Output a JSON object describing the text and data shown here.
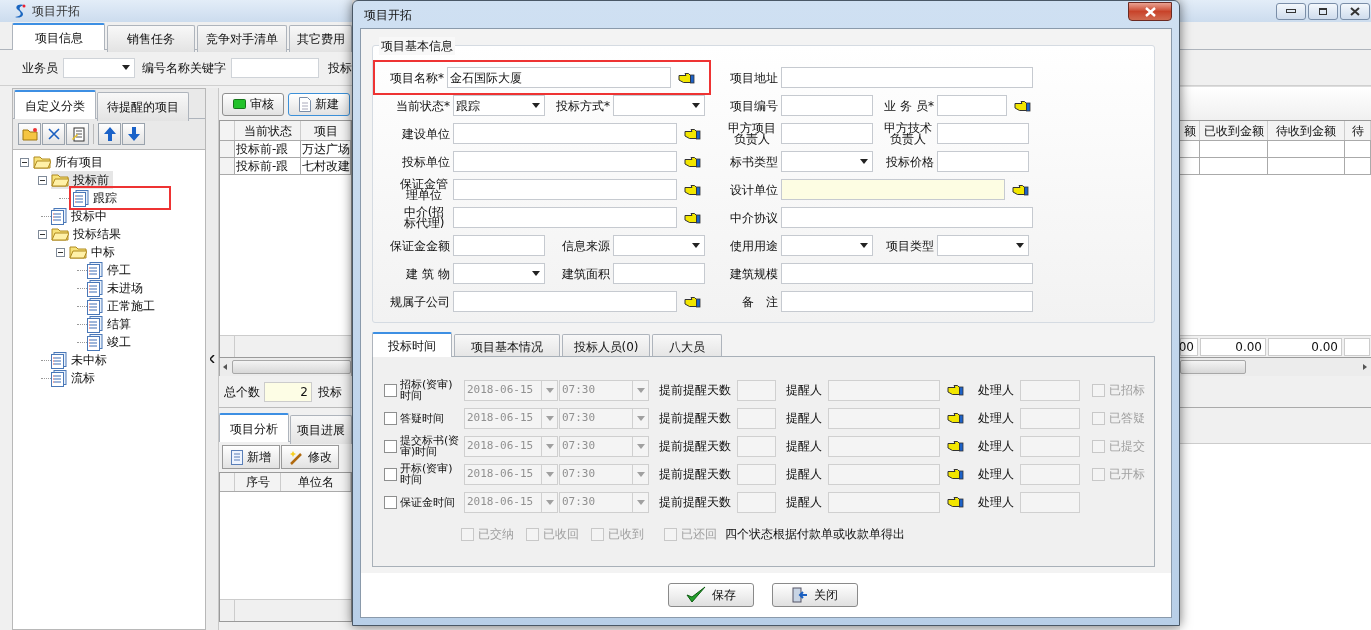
{
  "main_window": {
    "title": "项目开拓",
    "tabs": [
      {
        "label": "项目信息",
        "selected": true
      },
      {
        "label": "销售任务",
        "selected": false
      },
      {
        "label": "竞争对手清单",
        "selected": false
      },
      {
        "label": "其它费用",
        "selected": false
      }
    ],
    "filters": {
      "salesperson_label": "业务员",
      "keyword_label": "编号名称关键字",
      "trailing_label": "投标"
    }
  },
  "left_panel": {
    "tabs": [
      {
        "label": "自定义分类",
        "selected": true
      },
      {
        "label": "待提醒的项目",
        "selected": false
      }
    ],
    "tree": [
      {
        "label": "所有项目",
        "expanded": true,
        "selected": false,
        "children": [
          {
            "label": "投标前",
            "expanded": true,
            "selected": true,
            "children": [
              {
                "label": "跟踪",
                "selected": false,
                "annotated": true
              }
            ]
          },
          {
            "label": "投标中",
            "selected": false
          },
          {
            "label": "投标结果",
            "expanded": true,
            "selected": false,
            "children": [
              {
                "label": "中标",
                "expanded": true,
                "selected": false,
                "children": [
                  {
                    "label": "停工",
                    "selected": false
                  },
                  {
                    "label": "未进场",
                    "selected": false
                  },
                  {
                    "label": "正常施工",
                    "selected": false
                  },
                  {
                    "label": "结算",
                    "selected": false
                  },
                  {
                    "label": "竣工",
                    "selected": false
                  }
                ]
              }
            ]
          },
          {
            "label": "未中标",
            "selected": false
          },
          {
            "label": "流标",
            "selected": false
          }
        ]
      }
    ]
  },
  "project_list": {
    "buttons": [
      {
        "label": "审核",
        "kind": "approve",
        "focused": false
      },
      {
        "label": "新建",
        "kind": "new",
        "focused": true
      }
    ],
    "columns": [
      "当前状态",
      "项目"
    ],
    "rows": [
      [
        "投标前-跟",
        "万达广场"
      ],
      [
        "投标前-跟",
        "七村改建"
      ]
    ],
    "total_label": "总个数",
    "total": "2",
    "trailing_label": "投标"
  },
  "analysis": {
    "tabs": [
      {
        "label": "项目分析",
        "selected": true
      },
      {
        "label": "项目进展",
        "selected": false
      }
    ],
    "buttons": [
      {
        "label": "新增",
        "kind": "add"
      },
      {
        "label": "修改",
        "kind": "edit"
      }
    ],
    "columns": [
      "序号",
      "单位名"
    ]
  },
  "amounts": {
    "columns": [
      "额",
      "已收到金额",
      "待收到金额",
      "待"
    ],
    "totals": [
      "00",
      "0.00",
      "0.00"
    ]
  },
  "dialog": {
    "title": "项目开拓",
    "group_title": "项目基本信息",
    "form_rows": [
      {
        "left": [
          {
            "label": "项目名称*",
            "kind": "lookup",
            "value": "金石国际大厦",
            "annotated": true
          }
        ],
        "right": [
          {
            "label": "项目地址",
            "kind": "text"
          }
        ]
      },
      {
        "left": [
          {
            "label": "当前状态*",
            "kind": "select",
            "value": "跟踪"
          },
          {
            "label": "投标方式*",
            "kind": "select"
          }
        ],
        "right": [
          {
            "label": "项目编号",
            "kind": "text"
          },
          {
            "label": "业 务 员*",
            "kind": "lookup"
          }
        ]
      },
      {
        "left": [
          {
            "label": "建设单位",
            "kind": "lookup"
          }
        ],
        "right": [
          {
            "label": "甲方项目负责人",
            "kind": "text"
          },
          {
            "label": "甲方技术负责人",
            "kind": "text"
          }
        ]
      },
      {
        "left": [
          {
            "label": "投标单位",
            "kind": "lookup"
          }
        ],
        "right": [
          {
            "label": "标书类型",
            "kind": "select"
          },
          {
            "label": "投标价格",
            "kind": "text"
          }
        ]
      },
      {
        "left": [
          {
            "label": "保证金管理单位",
            "kind": "lookup"
          }
        ],
        "right": [
          {
            "label": "设计单位",
            "kind": "lookup",
            "readonly": true
          }
        ]
      },
      {
        "left": [
          {
            "label": "中介(招标代理)",
            "kind": "lookup"
          }
        ],
        "right": [
          {
            "label": "中介协议",
            "kind": "text"
          }
        ]
      },
      {
        "left": [
          {
            "label": "保证金金额",
            "kind": "text"
          },
          {
            "label": "信息来源",
            "kind": "select"
          }
        ],
        "right": [
          {
            "label": "使用用途",
            "kind": "select"
          },
          {
            "label": "项目类型",
            "kind": "select"
          }
        ]
      },
      {
        "left": [
          {
            "label": "建 筑 物",
            "kind": "select"
          },
          {
            "label": "建筑面积",
            "kind": "text"
          }
        ],
        "right": [
          {
            "label": "建筑规模",
            "kind": "text"
          }
        ]
      },
      {
        "left": [
          {
            "label": "规属子公司",
            "kind": "lookup"
          }
        ],
        "right": [
          {
            "label": "备　注",
            "kind": "text"
          }
        ]
      }
    ],
    "tabs": [
      {
        "label": "投标时间",
        "selected": true
      },
      {
        "label": "项目基本情况",
        "selected": false
      },
      {
        "label": "投标人员(0)",
        "selected": false
      },
      {
        "label": "八大员",
        "selected": false
      }
    ],
    "schedule": [
      {
        "label": "招标(资审)时间",
        "checked": false,
        "disabled": true,
        "date": "2018-06-15",
        "time": "07:30",
        "advance_label": "提前提醒天数",
        "reminder_label": "提醒人",
        "handler_label": "处理人",
        "done": {
          "label": "已招标",
          "checked": false
        }
      },
      {
        "label": "答疑时间",
        "checked": false,
        "disabled": true,
        "date": "2018-06-15",
        "time": "07:30",
        "advance_label": "提前提醒天数",
        "reminder_label": "提醒人",
        "handler_label": "处理人",
        "done": {
          "label": "已答疑",
          "checked": false
        }
      },
      {
        "label": "提交标书(资审)时间",
        "checked": false,
        "disabled": true,
        "date": "2018-06-15",
        "time": "07:30",
        "advance_label": "提前提醒天数",
        "reminder_label": "提醒人",
        "handler_label": "处理人",
        "done": {
          "label": "已提交",
          "checked": false
        }
      },
      {
        "label": "开标(资审)时间",
        "checked": false,
        "disabled": true,
        "date": "2018-06-15",
        "time": "07:30",
        "advance_label": "提前提醒天数",
        "reminder_label": "提醒人",
        "handler_label": "处理人",
        "done": {
          "label": "已开标",
          "checked": false
        }
      },
      {
        "label": "保证金时间",
        "checked": false,
        "disabled": true,
        "date": "2018-06-15",
        "time": "07:30",
        "advance_label": "提前提醒天数",
        "reminder_label": "提醒人",
        "handler_label": "处理人"
      }
    ],
    "deposit_states": [
      {
        "label": "已交纳",
        "checked": false
      },
      {
        "label": "已收回",
        "checked": false
      },
      {
        "label": "已收到",
        "checked": false
      },
      {
        "label": "已还回",
        "checked": false
      }
    ],
    "deposit_note": "四个状态根据付款单或收款单得出",
    "buttons": [
      {
        "label": "保存",
        "kind": "save"
      },
      {
        "label": "关闭",
        "kind": "close"
      }
    ]
  }
}
